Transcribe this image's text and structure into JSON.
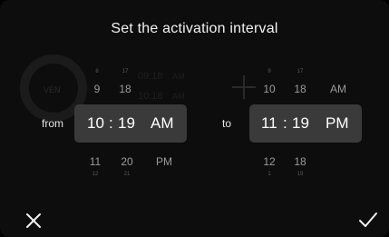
{
  "title": "Set the activation interval",
  "ghost": {
    "day": "VEN",
    "time_a": "09:18",
    "time_a_ampm": "AM",
    "time_b": "10:18",
    "time_b_ampm": "AM"
  },
  "from": {
    "label": "from",
    "above_tiny": [
      "8",
      "17"
    ],
    "above": [
      "9",
      "18",
      ""
    ],
    "selected": {
      "hour": "10",
      "minute": "19",
      "ampm": "AM"
    },
    "below": [
      "11",
      "20",
      "PM"
    ],
    "below_tiny": [
      "12",
      "21"
    ]
  },
  "to": {
    "label": "to",
    "above_tiny": [
      "9",
      "17"
    ],
    "above": [
      "10",
      "18",
      "AM"
    ],
    "selected": {
      "hour": "11",
      "minute": "19",
      "ampm": "PM"
    },
    "below": [
      "12",
      "18",
      ""
    ],
    "below_tiny": [
      "1",
      "19"
    ]
  },
  "colors": {
    "background": "#0d0d0d",
    "selection": "#3a3a3a",
    "text": "#ffffff"
  },
  "icons": {
    "cancel": "close-icon",
    "confirm": "check-icon"
  }
}
